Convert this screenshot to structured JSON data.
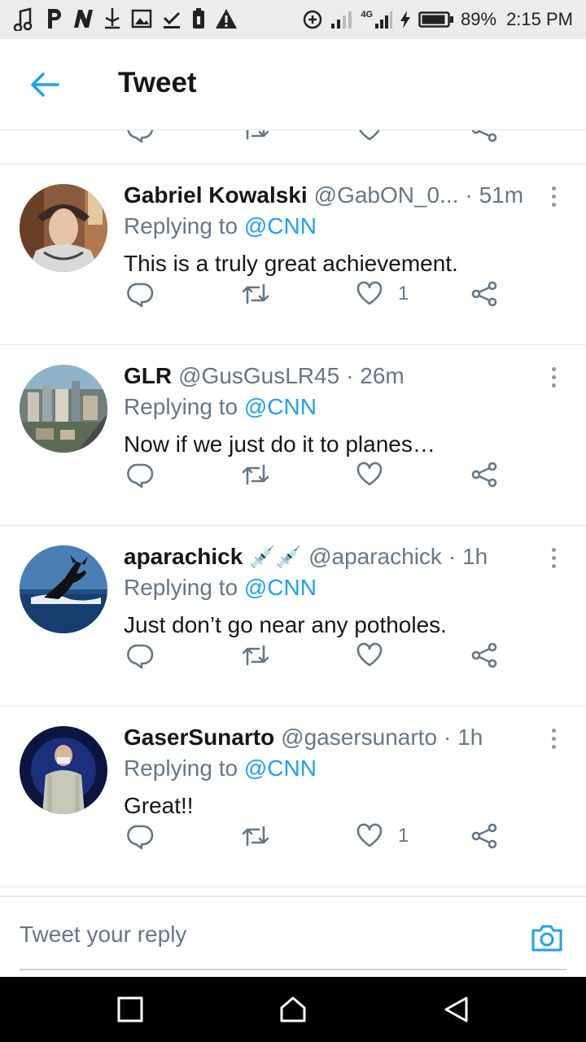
{
  "status_bar": {
    "battery": "89%",
    "time": "2:15 PM",
    "network": "4G",
    "left_icons": [
      "music-icon",
      "p-app-icon",
      "n-app-icon",
      "usb-icon",
      "image-icon",
      "download-done-icon",
      "battery-saver-icon",
      "warning-icon"
    ]
  },
  "header": {
    "title": "Tweet",
    "back_icon": "arrow-left-icon"
  },
  "colors": {
    "accent": "#1da1f2",
    "secondary_text": "#657786",
    "divider": "#e1e8ed"
  },
  "tweets": [
    {
      "name": "Gabriel Kowalski",
      "handle": "@GabON_0...",
      "time": "· 51m",
      "replying_prefix": "Replying to",
      "replying_to": "@CNN",
      "text": "This is a truly great achievement.",
      "like_count": "1"
    },
    {
      "name": "GLR",
      "handle": "@GusGusLR45",
      "time": "· 26m",
      "replying_prefix": "Replying to",
      "replying_to": "@CNN",
      "text": "Now if we just do it to planes…",
      "like_count": ""
    },
    {
      "name": "aparachick",
      "name_emoji": "💉💉",
      "handle": "@aparachick",
      "time": "· 1h",
      "replying_prefix": "Replying to",
      "replying_to": "@CNN",
      "text": "Just don’t go near any potholes.",
      "like_count": ""
    },
    {
      "name": "GaserSunarto",
      "handle": "@gasersunarto",
      "time": "· 1h",
      "replying_prefix": "Replying to",
      "replying_to": "@CNN",
      "text": "Great!!",
      "like_count": "1"
    }
  ],
  "reply_bar": {
    "placeholder": "Tweet your reply",
    "camera_icon": "camera-icon"
  },
  "nav_bar": {
    "icons": [
      "recents-square-icon",
      "home-icon",
      "back-triangle-icon"
    ]
  }
}
